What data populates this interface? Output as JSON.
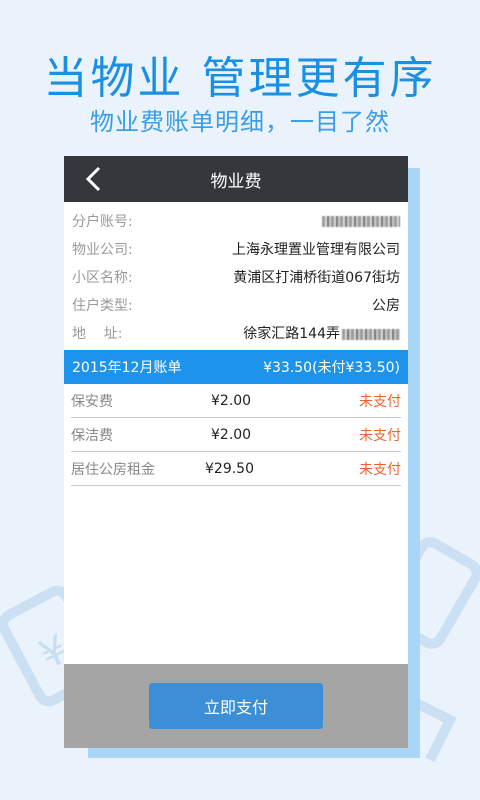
{
  "banner": {
    "headline": "当物业  管理更有序",
    "subline": "物业费账单明细，一目了然"
  },
  "titlebar": {
    "title": "物业费",
    "back_icon": "chevron-left-icon"
  },
  "info": [
    {
      "label": "分户账号:",
      "value": ""
    },
    {
      "label": "物业公司:",
      "value": "上海永理置业管理有限公司"
    },
    {
      "label": "小区名称:",
      "value": "黄浦区打浦桥街道067街坊"
    },
    {
      "label": "住户类型:",
      "value": "公房"
    },
    {
      "label": "地    址:",
      "value": "徐家汇路144弄"
    }
  ],
  "bill": {
    "period": "2015年12月账单",
    "summary": "¥33.50(未付¥33.50)"
  },
  "fees": [
    {
      "name": "保安费",
      "amount": "¥2.00",
      "status": "未支付"
    },
    {
      "name": "保洁费",
      "amount": "¥2.00",
      "status": "未支付"
    },
    {
      "name": "居住公房租金",
      "amount": "¥29.50",
      "status": "未支付"
    }
  ],
  "actions": {
    "pay_label": "立即支付"
  },
  "colors": {
    "accent": "#1e93ec",
    "titlebar": "#36373c",
    "unpaid": "#f0632b",
    "button": "#3c8fd6"
  }
}
